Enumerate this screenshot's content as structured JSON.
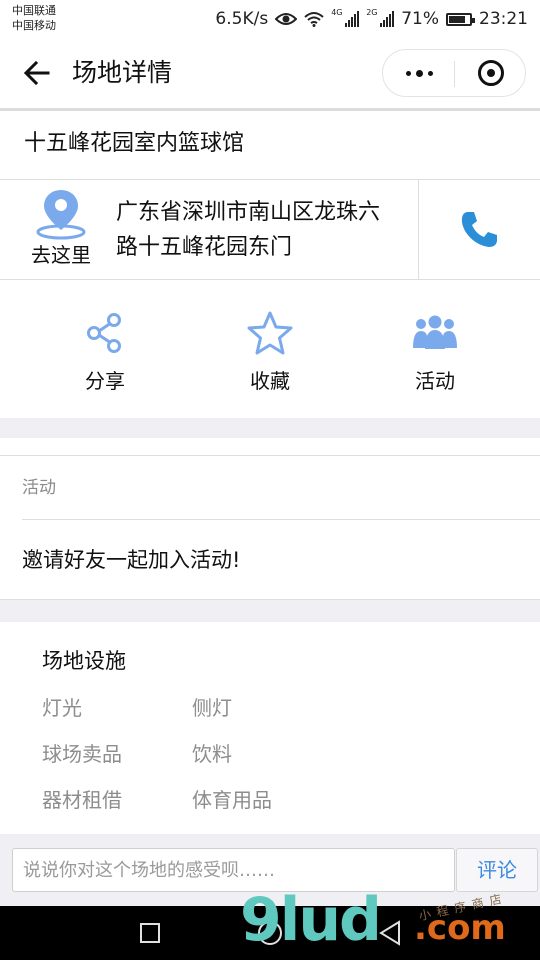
{
  "status_bar": {
    "carrier1": "中国联通",
    "carrier2": "中国移动",
    "speed": "6.5K/s",
    "sim1_tag": "4G",
    "sim2_tag": "2G",
    "battery": "71%",
    "time": "23:21"
  },
  "navbar": {
    "title": "场地详情"
  },
  "venue": {
    "name": "十五峰花园室内篮球馆",
    "go_label": "去这里",
    "address_line1": "广东省深圳市南山区龙珠六",
    "address_line2": "路十五峰花园东门"
  },
  "actions": [
    {
      "label": "分享",
      "icon": "share-icon"
    },
    {
      "label": "收藏",
      "icon": "star-icon"
    },
    {
      "label": "活动",
      "icon": "group-icon"
    }
  ],
  "activity": {
    "section_label": "活动",
    "invite_text": "邀请好友一起加入活动!"
  },
  "facilities": {
    "title": "场地设施",
    "rows": [
      [
        "灯光",
        "侧灯"
      ],
      [
        "球场卖品",
        "饮料"
      ],
      [
        "器材租借",
        "体育用品"
      ]
    ]
  },
  "comment": {
    "placeholder": "说说你对这个场地的感受呗……",
    "button": "评论"
  },
  "watermark": {
    "main": "9lud",
    "suffix": ".com",
    "small": "小程序商店"
  },
  "colors": {
    "accent": "#3d8ae0",
    "icon_blue": "#7aa9ec",
    "section_gray": "#efeff4"
  }
}
